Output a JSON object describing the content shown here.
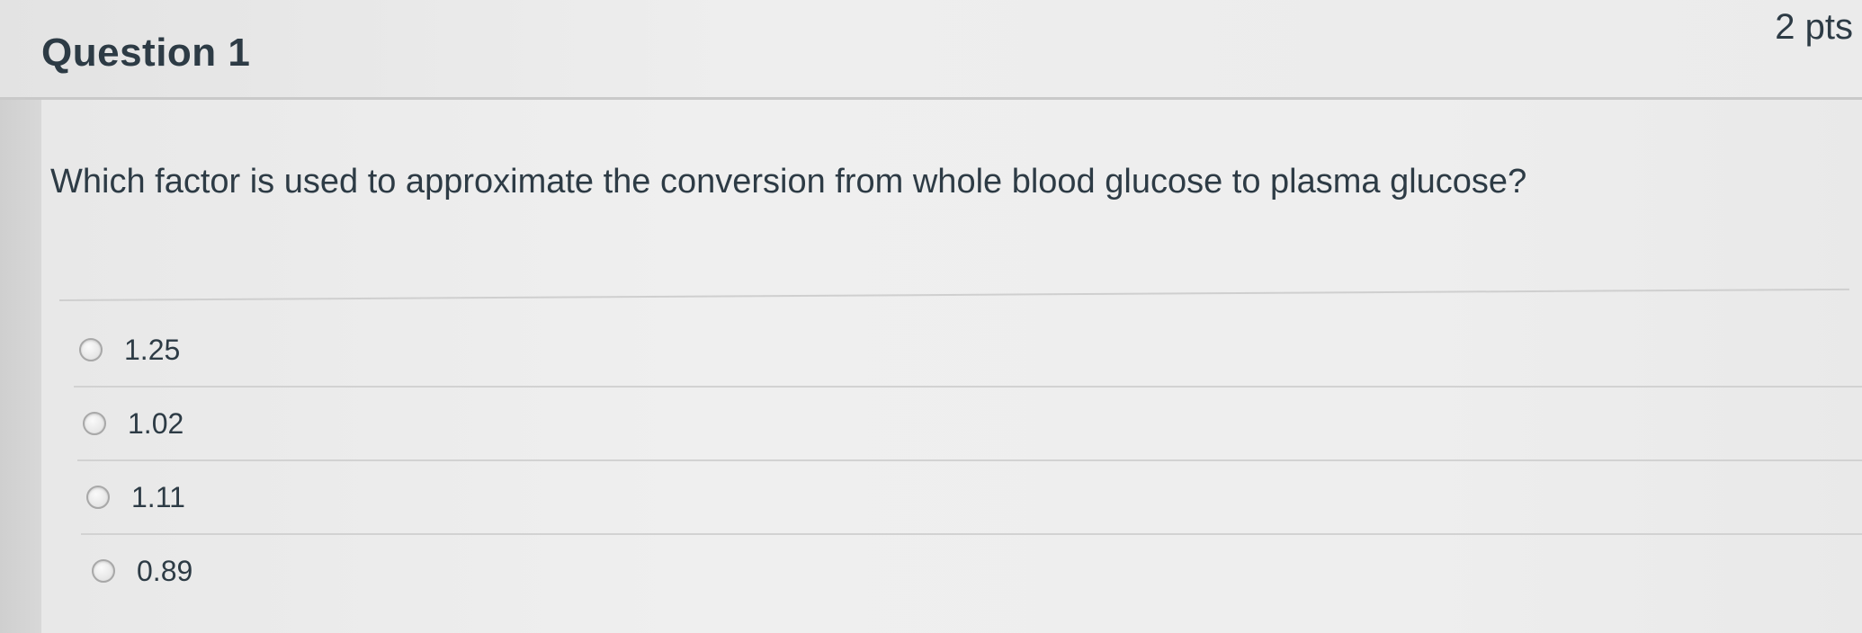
{
  "question": {
    "title": "Question 1",
    "points": "2 pts",
    "text": "Which factor is used to approximate the conversion from whole blood glucose to plasma glucose?",
    "answers": [
      {
        "label": "1.25",
        "selected": false
      },
      {
        "label": "1.02",
        "selected": false
      },
      {
        "label": "1.11",
        "selected": false
      },
      {
        "label": "0.89",
        "selected": false
      }
    ]
  },
  "icons": {
    "radio": "radio-button-icon"
  },
  "colors": {
    "text": "#2d3b45",
    "header_background": "#e8e8e8",
    "divider": "#c9c9c9"
  }
}
